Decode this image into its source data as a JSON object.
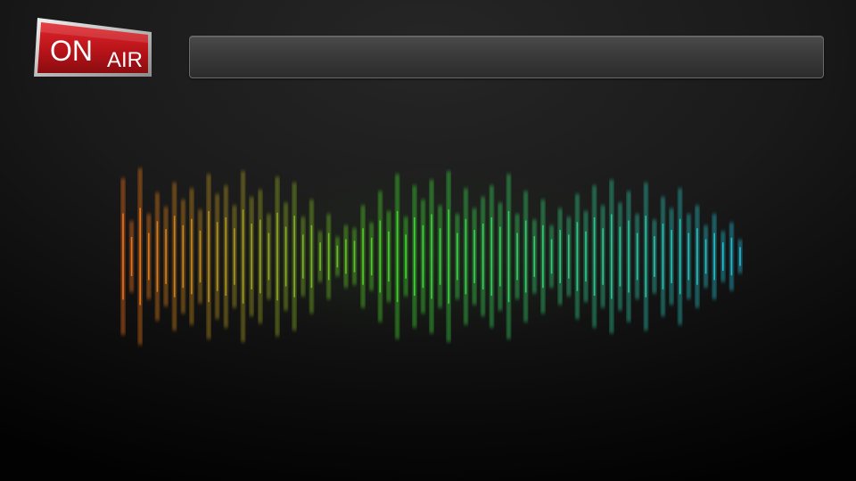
{
  "sign": {
    "on_text": "ON",
    "air_text": "AIR",
    "color": "#c4161c"
  },
  "title_bar": {
    "text": ""
  },
  "waveform": {
    "color_start": "#f26d1a",
    "color_mid": "#3ed62b",
    "color_end": "#22b9d8",
    "bars": [
      0.55,
      0.25,
      0.62,
      0.3,
      0.45,
      0.35,
      0.52,
      0.4,
      0.48,
      0.33,
      0.58,
      0.44,
      0.5,
      0.36,
      0.6,
      0.42,
      0.47,
      0.3,
      0.56,
      0.38,
      0.52,
      0.28,
      0.4,
      0.18,
      0.3,
      0.14,
      0.22,
      0.2,
      0.36,
      0.24,
      0.46,
      0.32,
      0.58,
      0.28,
      0.5,
      0.4,
      0.54,
      0.36,
      0.6,
      0.3,
      0.48,
      0.34,
      0.42,
      0.5,
      0.38,
      0.58,
      0.3,
      0.46,
      0.26,
      0.4,
      0.22,
      0.34,
      0.28,
      0.44,
      0.32,
      0.5,
      0.36,
      0.54,
      0.38,
      0.46,
      0.3,
      0.52,
      0.26,
      0.42,
      0.34,
      0.48,
      0.3,
      0.36,
      0.22,
      0.3,
      0.18,
      0.24,
      0.12
    ]
  }
}
